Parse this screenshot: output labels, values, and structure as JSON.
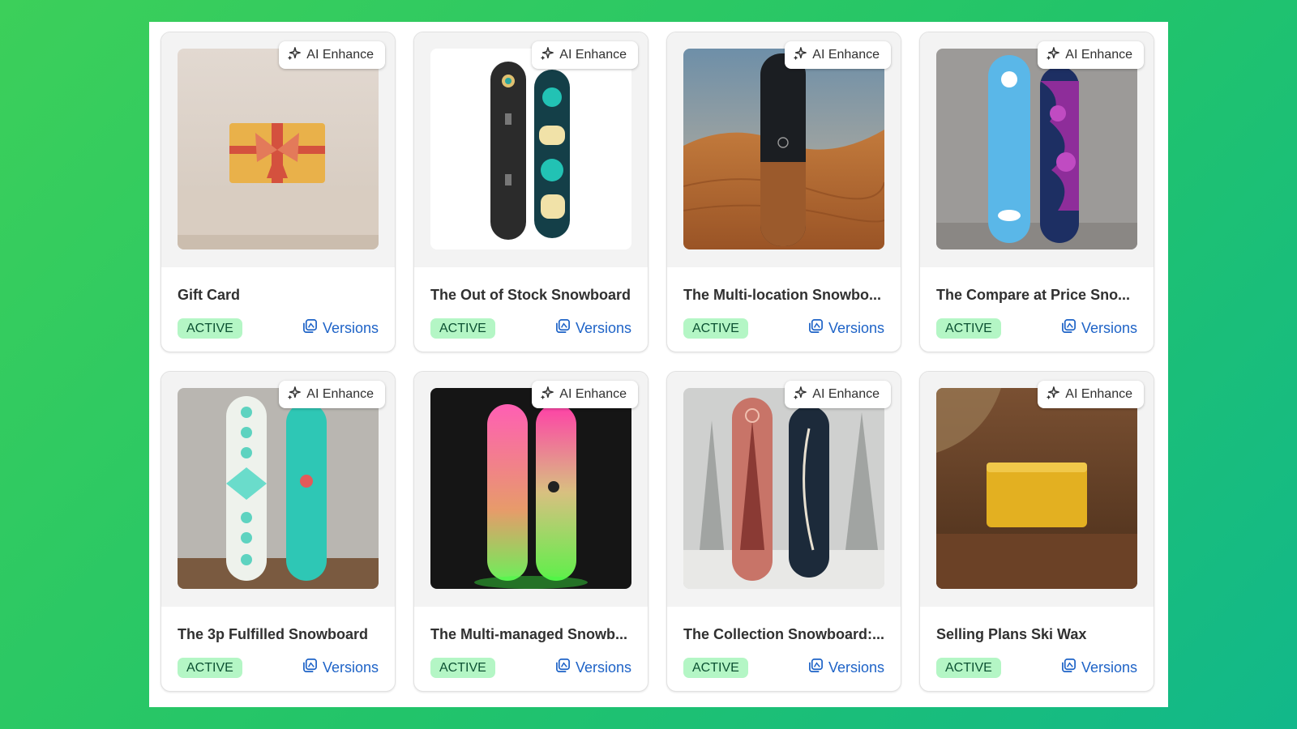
{
  "ai_button_label": "AI Enhance",
  "versions_label": "Versions",
  "colors": {
    "accent_link": "#1e63c7",
    "badge_bg": "#b4f6c5",
    "badge_text": "#0c5132"
  },
  "icons": {
    "ai": "sparkles-icon",
    "versions": "versions-icon"
  },
  "products": [
    {
      "title": "Gift Card",
      "status": "ACTIVE",
      "image": "gift-card"
    },
    {
      "title": "The Out of Stock Snowboard",
      "status": "ACTIVE",
      "image": "out-of-stock"
    },
    {
      "title": "The Multi-location Snowbo...",
      "status": "ACTIVE",
      "image": "multi-location"
    },
    {
      "title": "The Compare at Price Sno...",
      "status": "ACTIVE",
      "image": "compare-price"
    },
    {
      "title": "The 3p Fulfilled Snowboard",
      "status": "ACTIVE",
      "image": "3p-fulfilled"
    },
    {
      "title": "The Multi-managed Snowb...",
      "status": "ACTIVE",
      "image": "multi-managed"
    },
    {
      "title": "The Collection Snowboard:...",
      "status": "ACTIVE",
      "image": "collection"
    },
    {
      "title": "Selling Plans Ski Wax",
      "status": "ACTIVE",
      "image": "ski-wax"
    }
  ]
}
